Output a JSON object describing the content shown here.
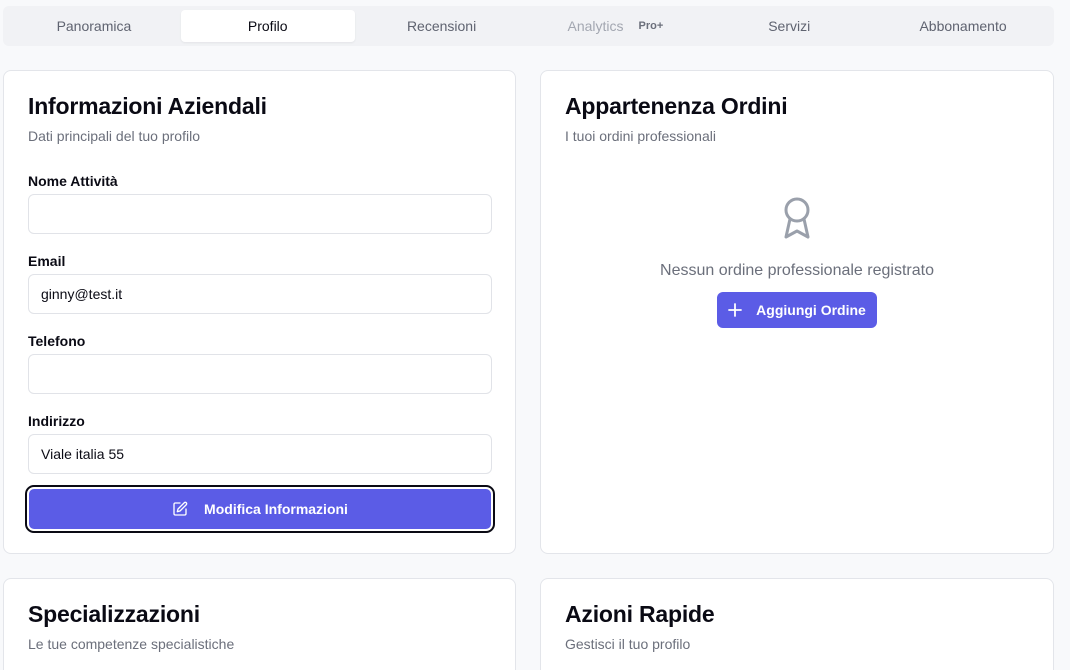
{
  "tabs": [
    {
      "label": "Panoramica"
    },
    {
      "label": "Profilo"
    },
    {
      "label": "Recensioni"
    },
    {
      "label": "Analytics",
      "badge": "Pro+"
    },
    {
      "label": "Servizi"
    },
    {
      "label": "Abbonamento"
    }
  ],
  "active_tab": "Profilo",
  "business_info": {
    "title": "Informazioni Aziendali",
    "subtitle": "Dati principali del tuo profilo",
    "fields": {
      "name": {
        "label": "Nome Attività",
        "value": ""
      },
      "email": {
        "label": "Email",
        "value": "ginny@test.it"
      },
      "phone": {
        "label": "Telefono",
        "value": ""
      },
      "address": {
        "label": "Indirizzo",
        "value": "Viale italia 55"
      }
    },
    "edit_button": "Modifica Informazioni"
  },
  "orders": {
    "title": "Appartenenza Ordini",
    "subtitle": "I tuoi ordini professionali",
    "empty_text": "Nessun ordine professionale registrato",
    "add_button": "Aggiungi Ordine"
  },
  "specializations": {
    "title": "Specializzazioni",
    "subtitle": "Le tue competenze specialistiche"
  },
  "quick_actions": {
    "title": "Azioni Rapide",
    "subtitle": "Gestisci il tuo profilo"
  },
  "colors": {
    "accent": "#5b5ce6",
    "background": "#f8f9fb",
    "muted_text": "#6b6f7b"
  },
  "icons": {
    "edit": "pencil-square-icon",
    "award": "award-ribbon-icon",
    "add": "plus-icon"
  }
}
